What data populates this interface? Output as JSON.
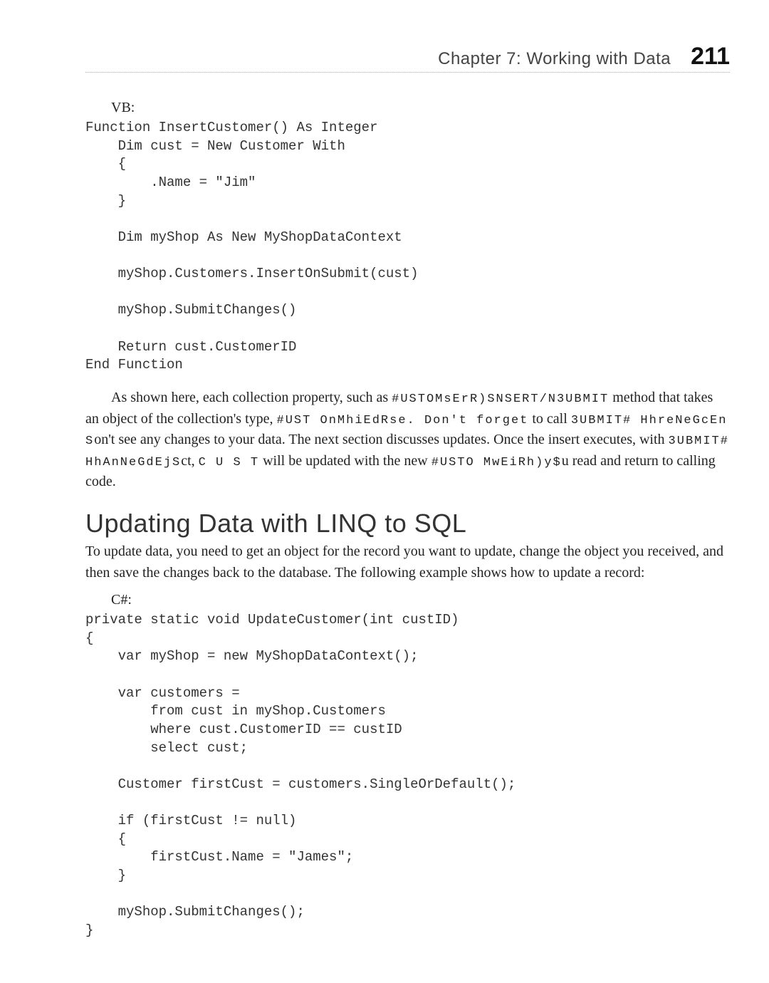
{
  "header": {
    "chapter": "Chapter 7:   Working with Data",
    "page": "211"
  },
  "label_vb": "VB:",
  "code_vb": "Function InsertCustomer() As Integer\n    Dim cust = New Customer With\n    {\n        .Name = \"Jim\"\n    }\n\n    Dim myShop As New MyShopDataContext\n\n    myShop.Customers.InsertOnSubmit(cust)\n\n    myShop.SubmitChanges()\n\n    Return cust.CustomerID\nEnd Function",
  "para1_a": "As shown here, each collection property, such as ",
  "para1_b": " method that takes an object of the collection's type, ",
  "para1_c": " to call ",
  "para1_d": "on't see any changes to your data. The next section discusses updates. Once the insert executes, with ",
  "para1_e": "ct, ",
  "para1_f": " will be updated with the new ",
  "para1_g": "u read and return to calling code.",
  "ic": {
    "customers_insert": "#USTOMsErR)SNSERT/N3UBMIT",
    "customer_case": "#UST OnMhiEdRse. Don't forget",
    "submit_or": "3UBMIT# HhreNeGcEn S",
    "submit_obj": "3UBMIT# HhAnNeGdEjS",
    "cust": "C U S T",
    "customerid_which": "#USTO MwEiRh)y$"
  },
  "section_title": "Updating Data with LINQ to SQL",
  "para2": "To update data, you need to get an object for the record you want to update, change the object you received, and then save the changes back to the database. The following example shows how to update a record:",
  "label_cs": "C#:",
  "code_cs": "private static void UpdateCustomer(int custID)\n{\n    var myShop = new MyShopDataContext();\n\n    var customers =\n        from cust in myShop.Customers\n        where cust.CustomerID == custID\n        select cust;\n\n    Customer firstCust = customers.SingleOrDefault();\n\n    if (firstCust != null)\n    {\n        firstCust.Name = \"James\";\n    }\n\n    myShop.SubmitChanges();\n}"
}
